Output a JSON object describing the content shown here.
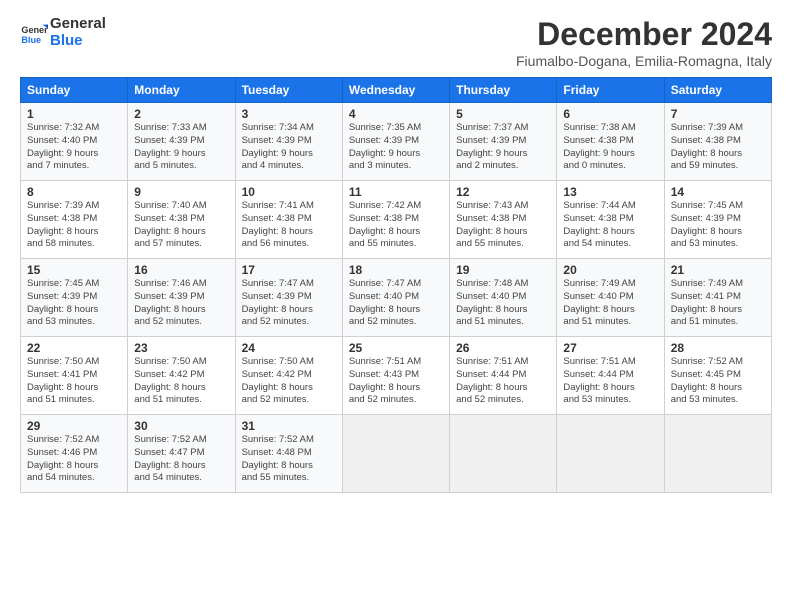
{
  "logo": {
    "text_general": "General",
    "text_blue": "Blue"
  },
  "header": {
    "title": "December 2024",
    "subtitle": "Fiumalbo-Dogana, Emilia-Romagna, Italy"
  },
  "weekdays": [
    "Sunday",
    "Monday",
    "Tuesday",
    "Wednesday",
    "Thursday",
    "Friday",
    "Saturday"
  ],
  "weeks": [
    [
      {
        "day": "1",
        "sunrise": "7:32 AM",
        "sunset": "4:40 PM",
        "daylight": "9 hours and 7 minutes."
      },
      {
        "day": "2",
        "sunrise": "7:33 AM",
        "sunset": "4:39 PM",
        "daylight": "9 hours and 5 minutes."
      },
      {
        "day": "3",
        "sunrise": "7:34 AM",
        "sunset": "4:39 PM",
        "daylight": "9 hours and 4 minutes."
      },
      {
        "day": "4",
        "sunrise": "7:35 AM",
        "sunset": "4:39 PM",
        "daylight": "9 hours and 3 minutes."
      },
      {
        "day": "5",
        "sunrise": "7:37 AM",
        "sunset": "4:39 PM",
        "daylight": "9 hours and 2 minutes."
      },
      {
        "day": "6",
        "sunrise": "7:38 AM",
        "sunset": "4:38 PM",
        "daylight": "9 hours and 0 minutes."
      },
      {
        "day": "7",
        "sunrise": "7:39 AM",
        "sunset": "4:38 PM",
        "daylight": "8 hours and 59 minutes."
      }
    ],
    [
      {
        "day": "8",
        "sunrise": "7:39 AM",
        "sunset": "4:38 PM",
        "daylight": "8 hours and 58 minutes."
      },
      {
        "day": "9",
        "sunrise": "7:40 AM",
        "sunset": "4:38 PM",
        "daylight": "8 hours and 57 minutes."
      },
      {
        "day": "10",
        "sunrise": "7:41 AM",
        "sunset": "4:38 PM",
        "daylight": "8 hours and 56 minutes."
      },
      {
        "day": "11",
        "sunrise": "7:42 AM",
        "sunset": "4:38 PM",
        "daylight": "8 hours and 55 minutes."
      },
      {
        "day": "12",
        "sunrise": "7:43 AM",
        "sunset": "4:38 PM",
        "daylight": "8 hours and 55 minutes."
      },
      {
        "day": "13",
        "sunrise": "7:44 AM",
        "sunset": "4:38 PM",
        "daylight": "8 hours and 54 minutes."
      },
      {
        "day": "14",
        "sunrise": "7:45 AM",
        "sunset": "4:39 PM",
        "daylight": "8 hours and 53 minutes."
      }
    ],
    [
      {
        "day": "15",
        "sunrise": "7:45 AM",
        "sunset": "4:39 PM",
        "daylight": "8 hours and 53 minutes."
      },
      {
        "day": "16",
        "sunrise": "7:46 AM",
        "sunset": "4:39 PM",
        "daylight": "8 hours and 52 minutes."
      },
      {
        "day": "17",
        "sunrise": "7:47 AM",
        "sunset": "4:39 PM",
        "daylight": "8 hours and 52 minutes."
      },
      {
        "day": "18",
        "sunrise": "7:47 AM",
        "sunset": "4:40 PM",
        "daylight": "8 hours and 52 minutes."
      },
      {
        "day": "19",
        "sunrise": "7:48 AM",
        "sunset": "4:40 PM",
        "daylight": "8 hours and 51 minutes."
      },
      {
        "day": "20",
        "sunrise": "7:49 AM",
        "sunset": "4:40 PM",
        "daylight": "8 hours and 51 minutes."
      },
      {
        "day": "21",
        "sunrise": "7:49 AM",
        "sunset": "4:41 PM",
        "daylight": "8 hours and 51 minutes."
      }
    ],
    [
      {
        "day": "22",
        "sunrise": "7:50 AM",
        "sunset": "4:41 PM",
        "daylight": "8 hours and 51 minutes."
      },
      {
        "day": "23",
        "sunrise": "7:50 AM",
        "sunset": "4:42 PM",
        "daylight": "8 hours and 51 minutes."
      },
      {
        "day": "24",
        "sunrise": "7:50 AM",
        "sunset": "4:42 PM",
        "daylight": "8 hours and 52 minutes."
      },
      {
        "day": "25",
        "sunrise": "7:51 AM",
        "sunset": "4:43 PM",
        "daylight": "8 hours and 52 minutes."
      },
      {
        "day": "26",
        "sunrise": "7:51 AM",
        "sunset": "4:44 PM",
        "daylight": "8 hours and 52 minutes."
      },
      {
        "day": "27",
        "sunrise": "7:51 AM",
        "sunset": "4:44 PM",
        "daylight": "8 hours and 53 minutes."
      },
      {
        "day": "28",
        "sunrise": "7:52 AM",
        "sunset": "4:45 PM",
        "daylight": "8 hours and 53 minutes."
      }
    ],
    [
      {
        "day": "29",
        "sunrise": "7:52 AM",
        "sunset": "4:46 PM",
        "daylight": "8 hours and 54 minutes."
      },
      {
        "day": "30",
        "sunrise": "7:52 AM",
        "sunset": "4:47 PM",
        "daylight": "8 hours and 54 minutes."
      },
      {
        "day": "31",
        "sunrise": "7:52 AM",
        "sunset": "4:48 PM",
        "daylight": "8 hours and 55 minutes."
      },
      null,
      null,
      null,
      null
    ]
  ]
}
